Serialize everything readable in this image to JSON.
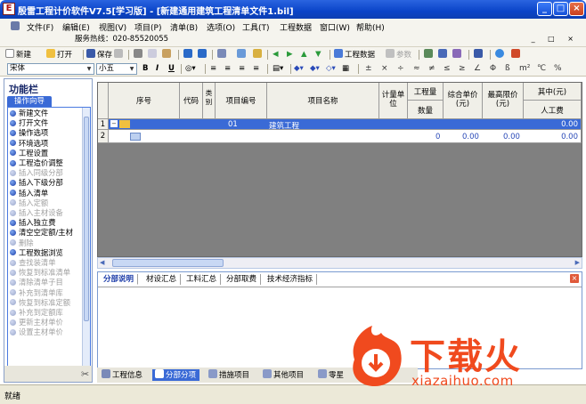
{
  "window": {
    "title": "殷雷工程计价软件V7.5[学习版] - [新建通用建筑工程清单文件1.bil]",
    "app_icon_glyph": "E"
  },
  "menu": {
    "items": [
      "文件(F)",
      "编辑(E)",
      "视图(V)",
      "项目(P)",
      "清单(B)",
      "选项(O)",
      "工具(T)",
      "工程数据",
      "窗口(W)",
      "帮助(H)"
    ],
    "hotline": "服务热线：020-85520055"
  },
  "toolbar": {
    "new": "新建",
    "open": "打开",
    "save": "保存",
    "project_data": "工程数据",
    "disabled_ref": "参数"
  },
  "format": {
    "font": "宋体",
    "size": "小五",
    "symbols": [
      "±",
      "×",
      "÷",
      "≈",
      "≠",
      "≤",
      "≥",
      "∠",
      "Φ",
      "ß",
      "m²",
      "℃",
      "%"
    ]
  },
  "sidebar": {
    "title": "功能栏",
    "tab": "操作向导",
    "items": [
      {
        "label": "新建文件",
        "enabled": true
      },
      {
        "label": "打开文件",
        "enabled": true
      },
      {
        "label": "操作选项",
        "enabled": true
      },
      {
        "label": "环境选项",
        "enabled": true
      },
      {
        "label": "工程设置",
        "enabled": true
      },
      {
        "label": "工程造价调整",
        "enabled": true
      },
      {
        "label": "插入同级分部",
        "enabled": false
      },
      {
        "label": "插入下级分部",
        "enabled": true
      },
      {
        "label": "插入清单",
        "enabled": true
      },
      {
        "label": "插入定额",
        "enabled": false
      },
      {
        "label": "插入主材设备",
        "enabled": false
      },
      {
        "label": "插入独立费",
        "enabled": true
      },
      {
        "label": "清空空定额/主材",
        "enabled": true
      },
      {
        "label": "删除",
        "enabled": false
      },
      {
        "label": "工程数据浏览",
        "enabled": true
      },
      {
        "label": "查找装清单",
        "enabled": false
      },
      {
        "label": "恢复到标准清单",
        "enabled": false
      },
      {
        "label": "清除清单子目",
        "enabled": false
      },
      {
        "label": "补充到清单库",
        "enabled": false
      },
      {
        "label": "恢复到标准定额",
        "enabled": false
      },
      {
        "label": "补充到定额库",
        "enabled": false
      },
      {
        "label": "更新主材单价",
        "enabled": false
      },
      {
        "label": "设置主材单价",
        "enabled": false
      }
    ]
  },
  "grid": {
    "headers": {
      "seq": "序号",
      "code": "代码",
      "calc": "类别",
      "item_no": "项目编号",
      "item_name": "项目名称",
      "unit": "计量单位",
      "qty_top": "工程量",
      "qty": "数量",
      "unit_price": "综合单价(元)",
      "max_price": "最高限价(元)",
      "of_which": "其中(元)",
      "labor": "人工费"
    },
    "rows": [
      {
        "row_no": "1",
        "item_no": "01",
        "item_name": "建筑工程",
        "qty": "",
        "unit_price": "",
        "max_price": "",
        "labor": "0.00"
      },
      {
        "row_no": "2",
        "item_no": "",
        "item_name": "",
        "qty": "0",
        "unit_price": "0.00",
        "max_price": "0.00",
        "labor": "0.00"
      }
    ]
  },
  "bottom_tabs": [
    "分部说明",
    "材设汇总",
    "工料汇总",
    "分部取费",
    "技术经济指标"
  ],
  "view_tabs": [
    "工程信息",
    "分部分项",
    "措施项目",
    "其他项目",
    "零星"
  ],
  "status": {
    "text": "就绪"
  },
  "watermark": {
    "brand": "下载火",
    "url": "xiazaihuo.com"
  },
  "colors": {
    "title_blue": "#0a44c8",
    "selected_row": "#3a6ad6",
    "accent_orange": "#f04a1e"
  }
}
